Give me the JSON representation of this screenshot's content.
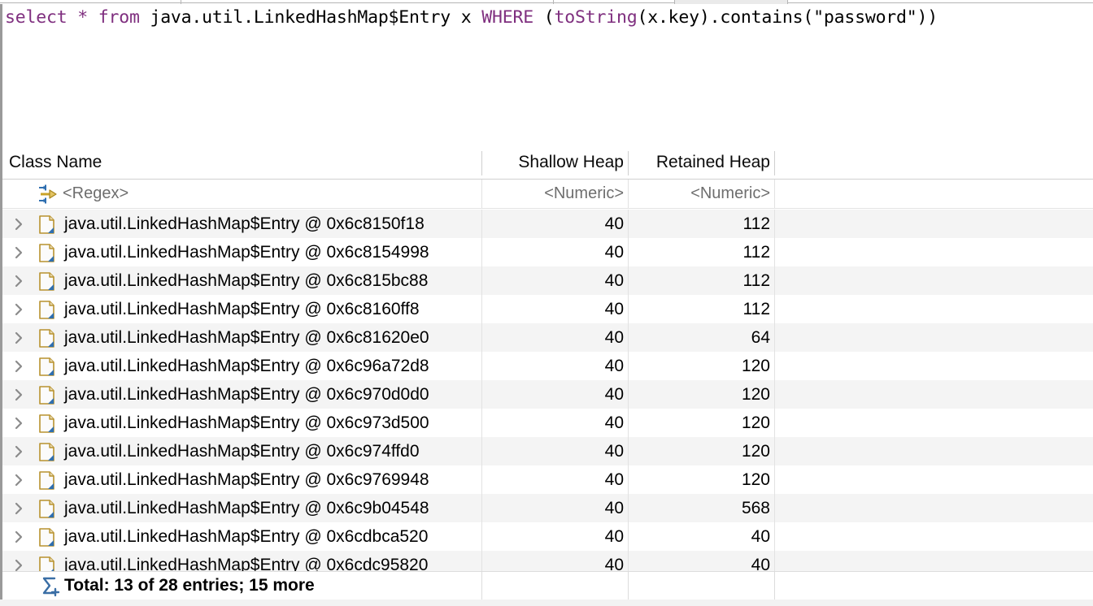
{
  "window": {
    "title": "Memory Analyzer OQL Result"
  },
  "tabs": {
    "dividers_note": "partial tab strip at top edge",
    "items": [
      {
        "label": "",
        "active": false
      },
      {
        "label": "",
        "active": false
      },
      {
        "label": "",
        "active": true
      },
      {
        "label": "",
        "active": false
      }
    ]
  },
  "query": {
    "tokens": [
      {
        "text": "select",
        "type": "keyword"
      },
      {
        "text": " ",
        "type": "plain"
      },
      {
        "text": "*",
        "type": "keyword"
      },
      {
        "text": " ",
        "type": "plain"
      },
      {
        "text": "from",
        "type": "keyword"
      },
      {
        "text": " java.util.LinkedHashMap$Entry x ",
        "type": "plain"
      },
      {
        "text": "WHERE",
        "type": "keyword"
      },
      {
        "text": " (",
        "type": "plain"
      },
      {
        "text": "toString",
        "type": "keyword"
      },
      {
        "text": "(x.key).contains(\"password\"))",
        "type": "plain"
      }
    ],
    "full_text": "select * from java.util.LinkedHashMap$Entry x WHERE (toString(x.key).contains(\"password\"))",
    "keyword_color": "#7f2f7f",
    "text_color": "#000000"
  },
  "table": {
    "columns": [
      {
        "key": "class_name",
        "label": "Class Name",
        "align": "left",
        "filter": "<Regex>"
      },
      {
        "key": "shallow_heap",
        "label": "Shallow Heap",
        "align": "right",
        "filter": "<Numeric>"
      },
      {
        "key": "retained_heap",
        "label": "Retained Heap",
        "align": "right",
        "filter": "<Numeric>"
      },
      {
        "key": "extra",
        "label": "",
        "align": "left",
        "filter": ""
      }
    ],
    "rows": [
      {
        "class_name": "java.util.LinkedHashMap$Entry @ 0x6c8150f18",
        "shallow_heap": "40",
        "retained_heap": "112"
      },
      {
        "class_name": "java.util.LinkedHashMap$Entry @ 0x6c8154998",
        "shallow_heap": "40",
        "retained_heap": "112"
      },
      {
        "class_name": "java.util.LinkedHashMap$Entry @ 0x6c815bc88",
        "shallow_heap": "40",
        "retained_heap": "112"
      },
      {
        "class_name": "java.util.LinkedHashMap$Entry @ 0x6c8160ff8",
        "shallow_heap": "40",
        "retained_heap": "112"
      },
      {
        "class_name": "java.util.LinkedHashMap$Entry @ 0x6c81620e0",
        "shallow_heap": "40",
        "retained_heap": "64"
      },
      {
        "class_name": "java.util.LinkedHashMap$Entry @ 0x6c96a72d8",
        "shallow_heap": "40",
        "retained_heap": "120"
      },
      {
        "class_name": "java.util.LinkedHashMap$Entry @ 0x6c970d0d0",
        "shallow_heap": "40",
        "retained_heap": "120"
      },
      {
        "class_name": "java.util.LinkedHashMap$Entry @ 0x6c973d500",
        "shallow_heap": "40",
        "retained_heap": "120"
      },
      {
        "class_name": "java.util.LinkedHashMap$Entry @ 0x6c974ffd0",
        "shallow_heap": "40",
        "retained_heap": "120"
      },
      {
        "class_name": "java.util.LinkedHashMap$Entry @ 0x6c9769948",
        "shallow_heap": "40",
        "retained_heap": "120"
      },
      {
        "class_name": "java.util.LinkedHashMap$Entry @ 0x6c9b04548",
        "shallow_heap": "40",
        "retained_heap": "568"
      },
      {
        "class_name": "java.util.LinkedHashMap$Entry @ 0x6cdbca520",
        "shallow_heap": "40",
        "retained_heap": "40"
      },
      {
        "class_name": "java.util.LinkedHashMap$Entry @ 0x6cdc95820",
        "shallow_heap": "40",
        "retained_heap": "40"
      }
    ],
    "total": {
      "label": "Total: 13 of 28 entries; 15 more",
      "shown": 13,
      "entries": 28,
      "more": 15,
      "icon": "sum-plus-icon"
    },
    "icons": {
      "expand": "chevron-right-icon",
      "object": "java-object-icon",
      "filter": "filter-regex-icon"
    }
  },
  "colors": {
    "row_odd": "#f4f4f4",
    "row_even": "#ffffff",
    "grid_line": "#e2e2e2",
    "header_text": "#0a0a0a",
    "filter_text": "#6e6e6e",
    "icon_gold": "#b8922e",
    "icon_blue": "#3c6ea5",
    "sum_blue": "#3a6ea5"
  }
}
